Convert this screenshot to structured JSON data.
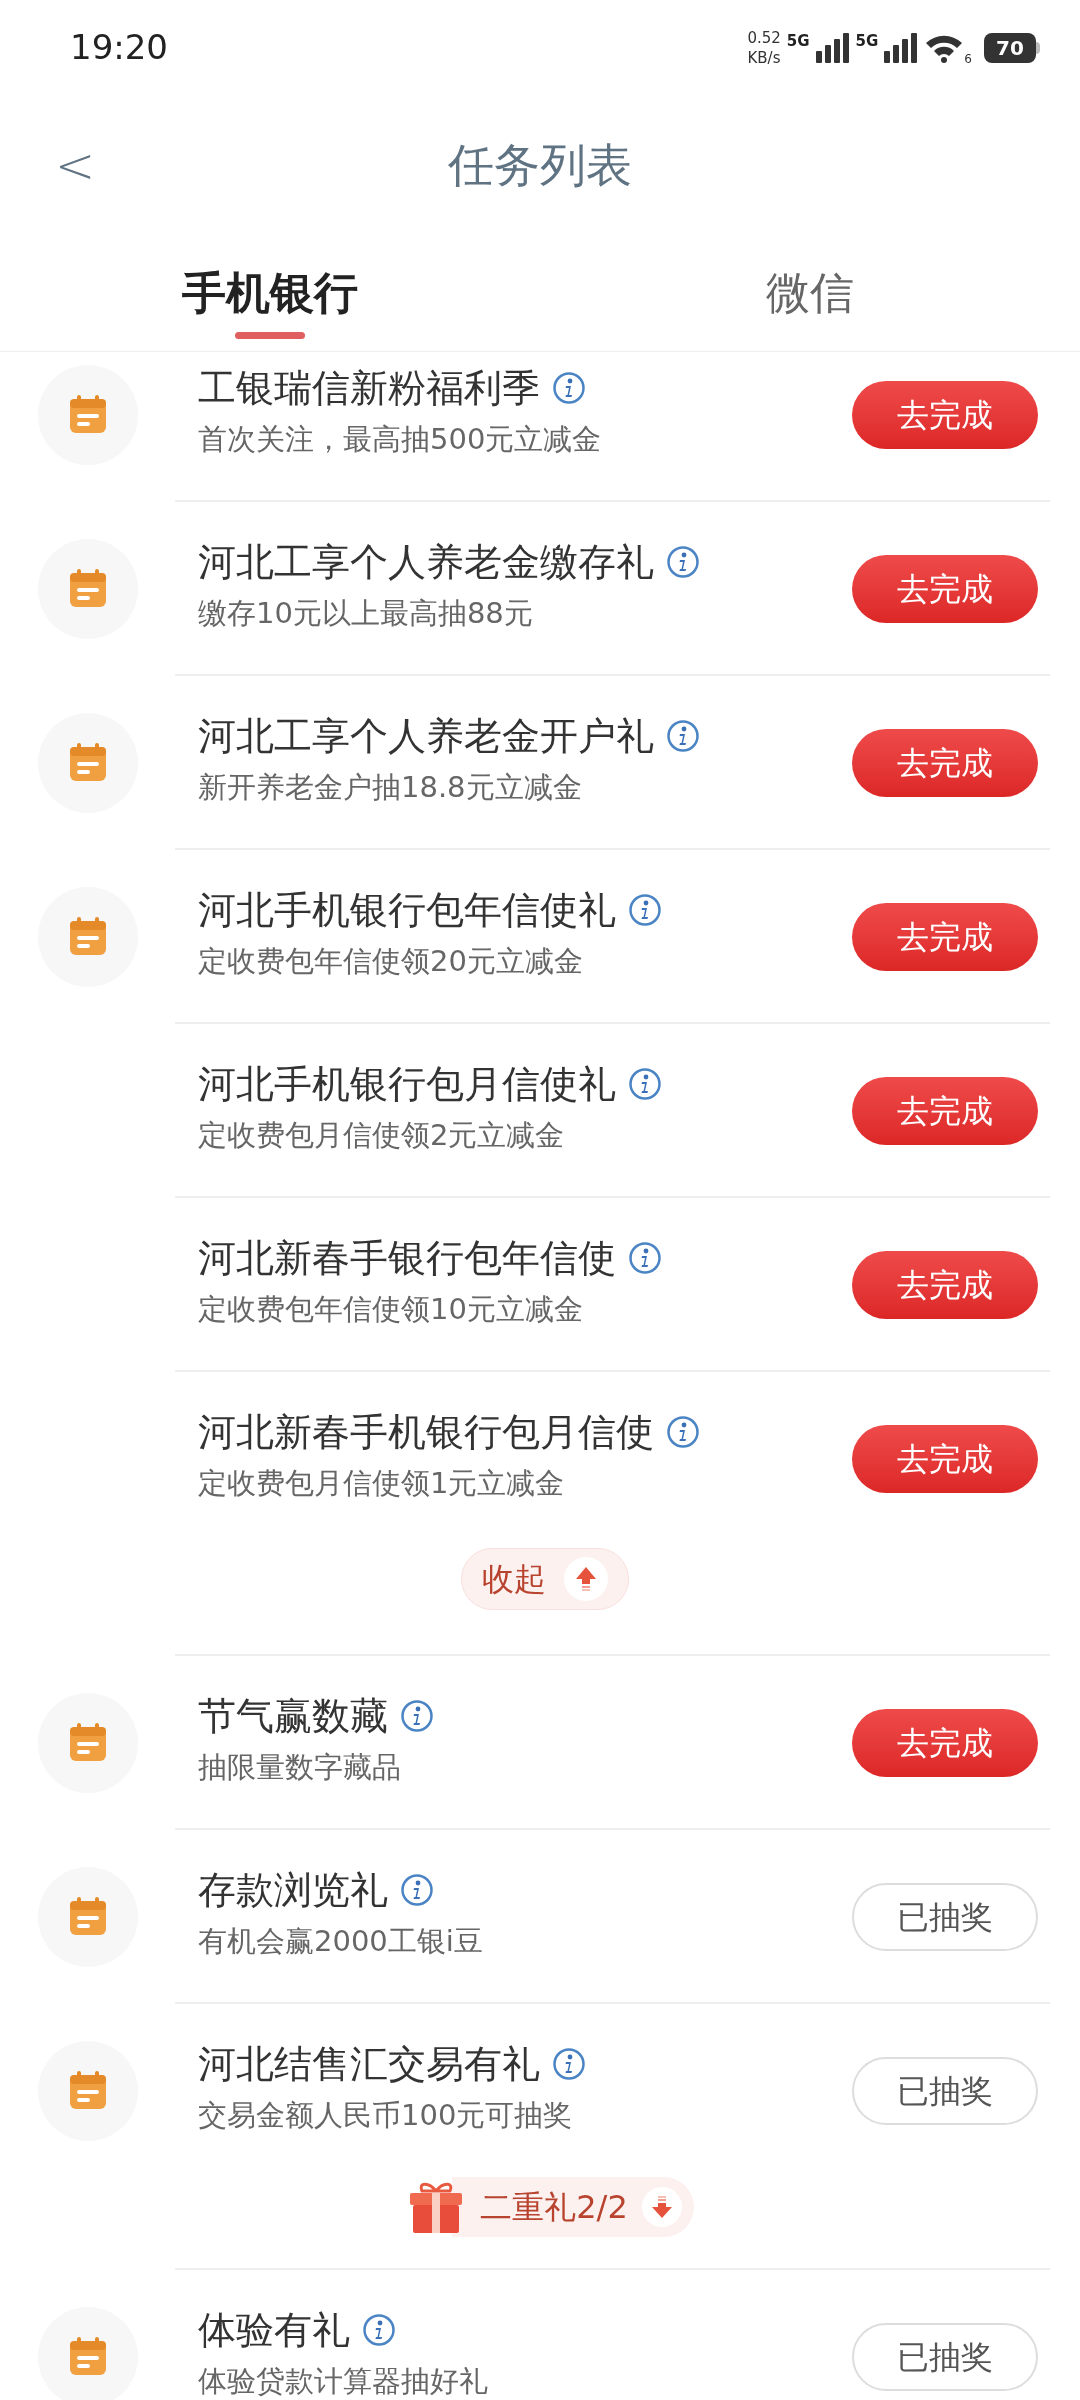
{
  "status_bar": {
    "time": "19:20",
    "net_speed": "0.52",
    "net_unit": "KB/s",
    "sim_1": "5G",
    "sim_2": "5G",
    "wifi_label": "6",
    "battery": "70"
  },
  "header": {
    "back": "<",
    "title": "任务列表"
  },
  "tabs": [
    {
      "label": "手机银行",
      "selected": true
    },
    {
      "label": "微信",
      "selected": false
    }
  ],
  "entries": [
    {
      "kind": "task",
      "title": "工银瑞信新粉福利季",
      "subtitle": "首次关注，最高抽500元立减金",
      "has_icon": true,
      "button": "去完成",
      "done": false
    },
    {
      "kind": "task",
      "title": "河北工享个人养老金缴存礼",
      "subtitle": "缴存10元以上最高抽88元",
      "has_icon": true,
      "button": "去完成",
      "done": false
    },
    {
      "kind": "task",
      "title": "河北工享个人养老金开户礼",
      "subtitle": "新开养老金户抽18.8元立减金",
      "has_icon": true,
      "button": "去完成",
      "done": false
    },
    {
      "kind": "task",
      "title": "河北手机银行包年信使礼",
      "subtitle": "定收费包年信使领20元立减金",
      "has_icon": true,
      "button": "去完成",
      "done": false
    },
    {
      "kind": "task",
      "title": "河北手机银行包月信使礼",
      "subtitle": "定收费包月信使领2元立减金",
      "has_icon": false,
      "button": "去完成",
      "done": false
    },
    {
      "kind": "task",
      "title": "河北新春手银行包年信使",
      "subtitle": "定收费包年信使领10元立减金",
      "has_icon": false,
      "button": "去完成",
      "done": false
    },
    {
      "kind": "task",
      "title": "河北新春手机银行包月信使",
      "subtitle": "定收费包月信使领1元立减金",
      "has_icon": false,
      "button": "去完成",
      "done": false
    },
    {
      "kind": "collapse",
      "label": "收起"
    },
    {
      "kind": "task",
      "title": "节气赢数藏",
      "subtitle": "抽限量数字藏品",
      "has_icon": true,
      "button": "去完成",
      "done": false
    },
    {
      "kind": "task",
      "title": "存款浏览礼",
      "subtitle": "有机会赢2000工银i豆",
      "has_icon": true,
      "button": "已抽奖",
      "done": true
    },
    {
      "kind": "task",
      "title": "河北结售汇交易有礼",
      "subtitle": "交易金额人民币100元可抽奖",
      "has_icon": true,
      "button": "已抽奖",
      "done": true
    },
    {
      "kind": "bonus",
      "label": "二重礼2/2"
    },
    {
      "kind": "task",
      "title": "体验有礼",
      "subtitle": "体验贷款计算器抽好礼",
      "has_icon": true,
      "button": "已抽奖",
      "done": true
    }
  ]
}
